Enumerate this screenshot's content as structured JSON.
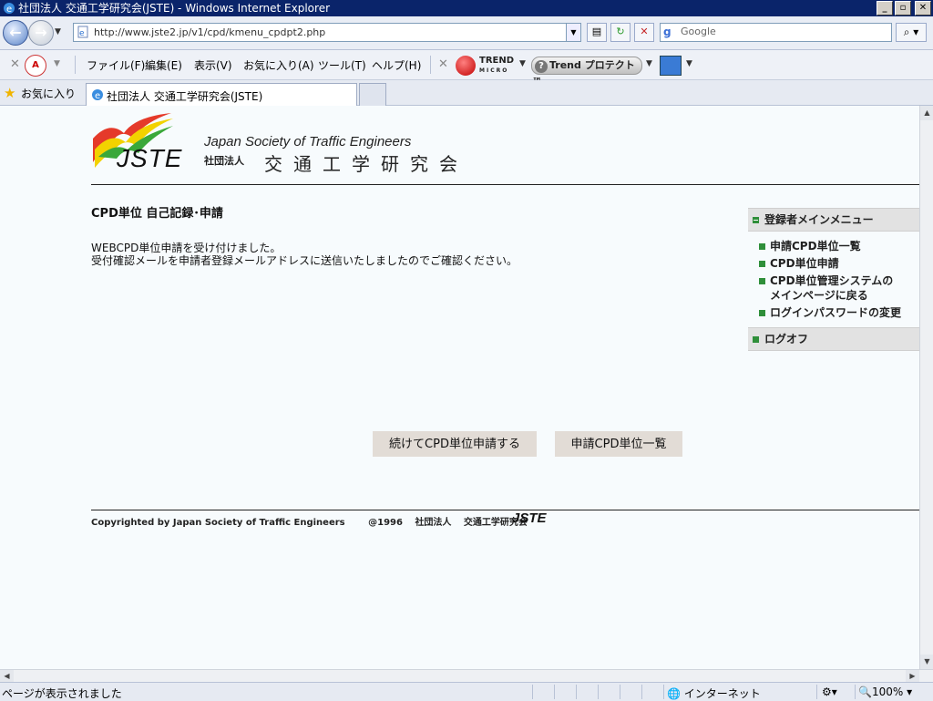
{
  "window": {
    "title": "社団法人 交通工学研究会(JSTE) - Windows Internet Explorer",
    "min_label": "_",
    "max_label": "▫",
    "close_label": "✕"
  },
  "address_bar": {
    "url": "http://www.jste2.jp/v1/cpd/kmenu_cpdpt2.php",
    "search_placeholder": "Google",
    "search_icon": "search-icon"
  },
  "menu": {
    "items": [
      "ファイル(F)",
      "編集(E)",
      "表示(V)",
      "お気に入り(A)",
      "ツール(T)",
      "ヘルプ(H)"
    ]
  },
  "toolbar": {
    "trend_line1": "TREND",
    "trend_line2": "MICRO",
    "trend_button": "Trend プロテクト™"
  },
  "favorites": {
    "label": "お気に入り",
    "tab_title": "社団法人 交通工学研究会(JSTE)"
  },
  "page": {
    "logo_text": "JSTE",
    "logo_en": "Japan Society of Traffic Engineers",
    "logo_shadan": "社団法人",
    "logo_jp": "交通工学研究会",
    "title": "CPD単位 自己記録･申請",
    "message_line1": "WEBCPD単位申請を受け付けました。",
    "message_line2": "受付確認メールを申請者登録メールアドレスに送信いたしましたのでご確認ください。",
    "buttons": {
      "continue": "続けてCPD単位申請する",
      "list": "申請CPD単位一覧"
    },
    "footer": {
      "copyright": "Copyrighted by Japan Society of Traffic Engineers",
      "year": "@1996",
      "shadan": "社団法人",
      "org": "交通工学研究会",
      "logo": "JSTE"
    }
  },
  "sidebar": {
    "heading": "登録者メインメニュー",
    "items": [
      {
        "label": "申請CPD単位一覧"
      },
      {
        "label": "CPD単位申請"
      },
      {
        "label": "CPD単位管理システムの"
      },
      {
        "label": "メインページに戻る"
      },
      {
        "label": "ログインパスワードの変更"
      }
    ],
    "logoff": "ログオフ"
  },
  "status": {
    "text": "ページが表示されました",
    "zone": "インターネット",
    "zoom": "100%"
  },
  "colors": {
    "title_bar": "#0a246a",
    "page_bg": "#f7fbfd",
    "accent_green": "#2f8f3a",
    "button_bg": "#e2dcd6"
  }
}
